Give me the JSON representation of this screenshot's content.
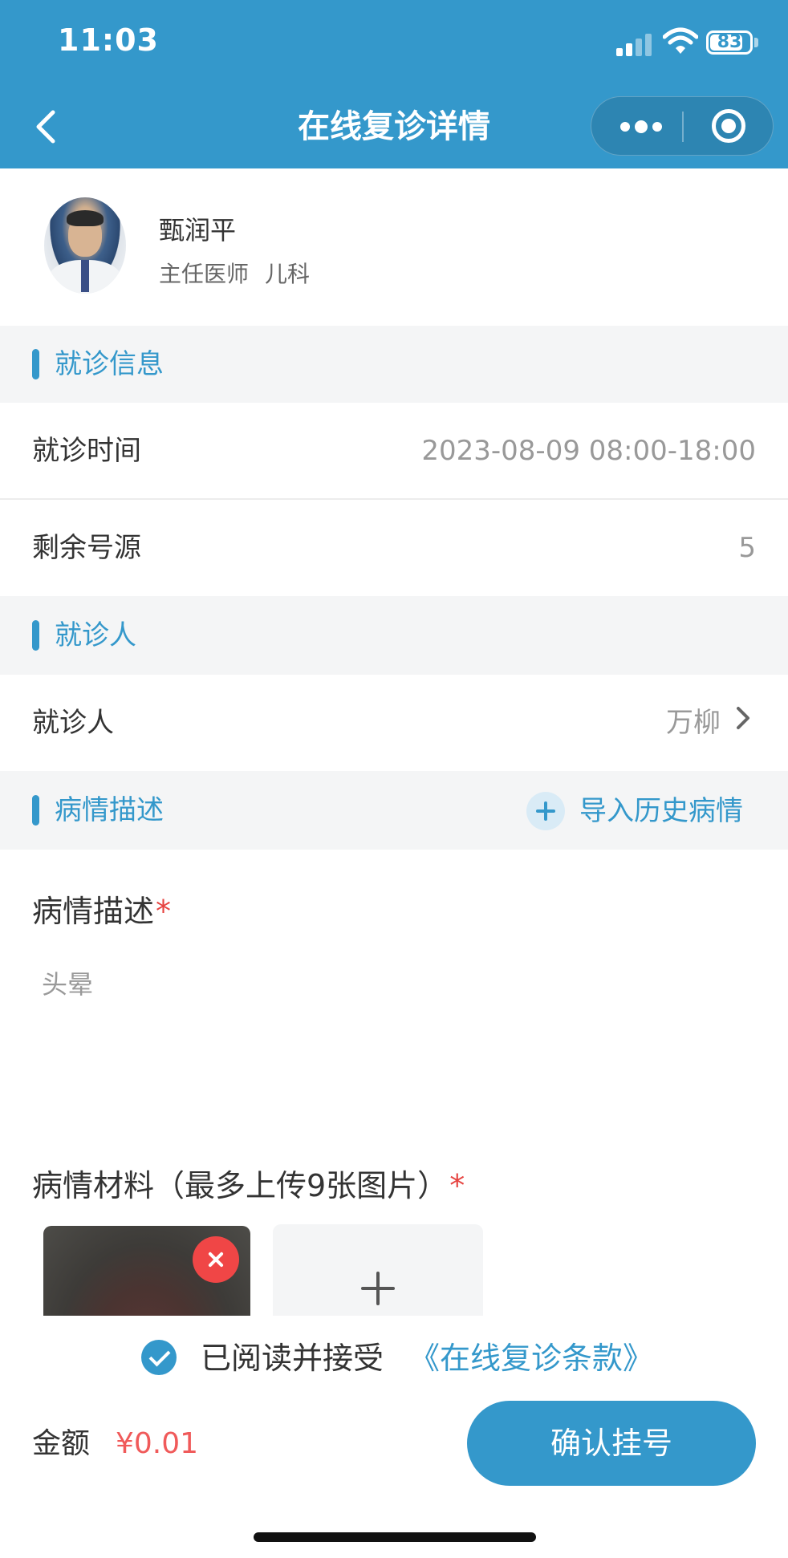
{
  "status_bar": {
    "time": "11:03",
    "battery": "83",
    "battery_level": 0.83,
    "icons": [
      "cellular-signal-icon",
      "wifi-icon",
      "battery-icon"
    ]
  },
  "nav": {
    "title": "在线复诊详情",
    "icons": [
      "back-arrow-icon",
      "more-dots-icon",
      "close-target-icon"
    ]
  },
  "doctor": {
    "name": "甄润平",
    "title": "主任医师",
    "department": "儿科"
  },
  "sections": {
    "visit_info": "就诊信息",
    "patient": "就诊人",
    "condition": "病情描述"
  },
  "visit_info": {
    "time_label": "就诊时间",
    "time_value": "2023-08-09 08:00-18:00",
    "remaining_label": "剩余号源",
    "remaining_value": "5"
  },
  "patient": {
    "label": "就诊人",
    "value": "万柳"
  },
  "condition": {
    "import_label": "导入历史病情",
    "desc_label": "病情描述",
    "required_mark": "*",
    "desc_text": "头晕",
    "materials_label": "病情材料（最多上传9张图片）",
    "uploaded_count": 1
  },
  "agreement": {
    "text": "已阅读并接受",
    "link": "《在线复诊条款》",
    "checked": true
  },
  "footer": {
    "amount_label": "金额",
    "amount_value": "¥0.01",
    "confirm_label": "确认挂号"
  },
  "colors": {
    "brand": "#3498cb",
    "price": "#f05a5a",
    "required": "#e64340",
    "delete": "#f04646"
  }
}
